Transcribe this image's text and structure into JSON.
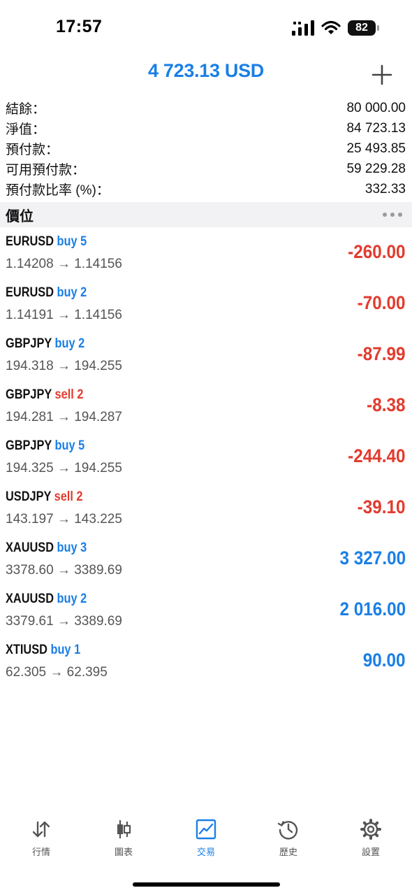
{
  "status_bar": {
    "time": "17:57",
    "battery": "82"
  },
  "header": {
    "title": "4 723.13 USD"
  },
  "summary": [
    {
      "label": "結餘：",
      "value": "80 000.00"
    },
    {
      "label": "淨值：",
      "value": "84 723.13"
    },
    {
      "label": "預付款：",
      "value": "25 493.85"
    },
    {
      "label": "可用預付款：",
      "value": "59 229.28"
    },
    {
      "label": "預付款比率 (%)：",
      "value": "332.33"
    }
  ],
  "positions_section": {
    "title": "價位"
  },
  "positions": [
    {
      "symbol": "EURUSD",
      "type": "buy 5",
      "prices": "1.14208 → 1.14156",
      "profit": "-260.00",
      "direction": "buy",
      "profit_sign": "negative"
    },
    {
      "symbol": "EURUSD",
      "type": "buy 2",
      "prices": "1.14191 → 1.14156",
      "profit": "-70.00",
      "direction": "buy",
      "profit_sign": "negative"
    },
    {
      "symbol": "GBPJPY",
      "type": "buy 2",
      "prices": "194.318 → 194.255",
      "profit": "-87.99",
      "direction": "buy",
      "profit_sign": "negative"
    },
    {
      "symbol": "GBPJPY",
      "type": "sell 2",
      "prices": "194.281 → 194.287",
      "profit": "-8.38",
      "direction": "sell",
      "profit_sign": "negative"
    },
    {
      "symbol": "GBPJPY",
      "type": "buy 5",
      "prices": "194.325 → 194.255",
      "profit": "-244.40",
      "direction": "buy",
      "profit_sign": "negative"
    },
    {
      "symbol": "USDJPY",
      "type": "sell 2",
      "prices": "143.197 → 143.225",
      "profit": "-39.10",
      "direction": "sell",
      "profit_sign": "negative"
    },
    {
      "symbol": "XAUUSD",
      "type": "buy 3",
      "prices": "3378.60 → 3389.69",
      "profit": "3 327.00",
      "direction": "buy",
      "profit_sign": "positive"
    },
    {
      "symbol": "XAUUSD",
      "type": "buy 2",
      "prices": "3379.61 → 3389.69",
      "profit": "2 016.00",
      "direction": "buy",
      "profit_sign": "positive"
    },
    {
      "symbol": "XTIUSD",
      "type": "buy 1",
      "prices": "62.305 → 62.395",
      "profit": "90.00",
      "direction": "buy",
      "profit_sign": "positive"
    }
  ],
  "tabs": [
    {
      "label": "行情",
      "icon": "quotes-arrows-icon",
      "active": false
    },
    {
      "label": "圖表",
      "icon": "candlestick-chart-icon",
      "active": false
    },
    {
      "label": "交易",
      "icon": "trade-chart-icon",
      "active": true
    },
    {
      "label": "歷史",
      "icon": "history-clock-icon",
      "active": false
    },
    {
      "label": "設置",
      "icon": "settings-gear-icon",
      "active": false
    }
  ],
  "colors": {
    "accent": "#1a7fe6",
    "loss": "#e23b2e",
    "section_background": "#f2f2f4",
    "tab_inactive": "#555555"
  }
}
